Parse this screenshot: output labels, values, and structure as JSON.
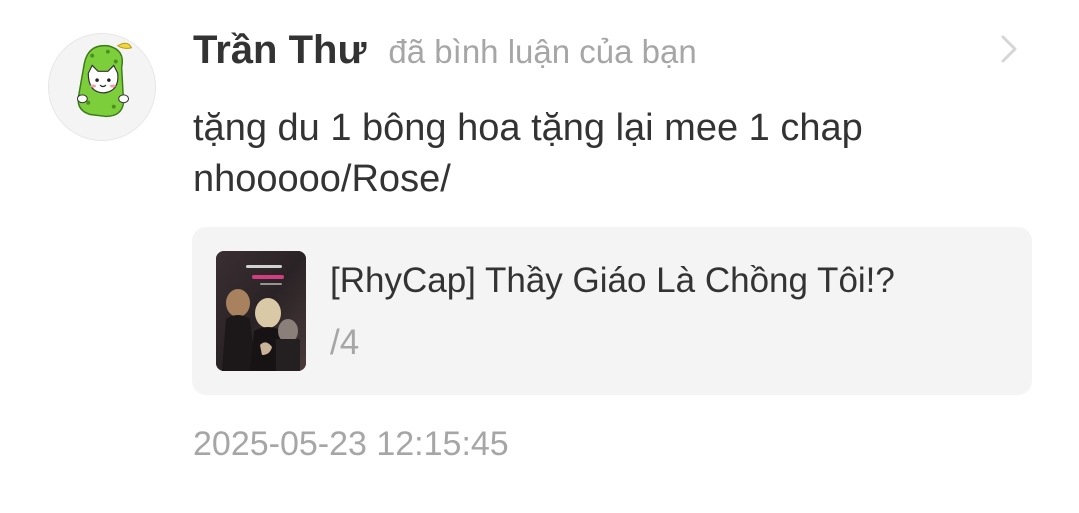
{
  "notification": {
    "user_name": "Trần Thư",
    "action": "đã bình luận của bạn",
    "comment": "tặng du 1 bông hoa tặng lại mee 1 chap nhooooo/Rose/",
    "timestamp": "2025-05-23 12:15:45",
    "card": {
      "title": "[RhyCap] Thầy Giáo Là Chồng Tôi!?",
      "subtitle": "/4"
    },
    "colors": {
      "primary_text": "#333333",
      "secondary_text": "#a6a6a6",
      "card_bg": "#f4f4f5",
      "avatar_green": "#7ccf3a"
    },
    "icons": {
      "avatar": "cucumber-cat-avatar-icon",
      "chevron": "chevron-right-icon",
      "thumbnail": "comic-cover-thumbnail"
    }
  }
}
